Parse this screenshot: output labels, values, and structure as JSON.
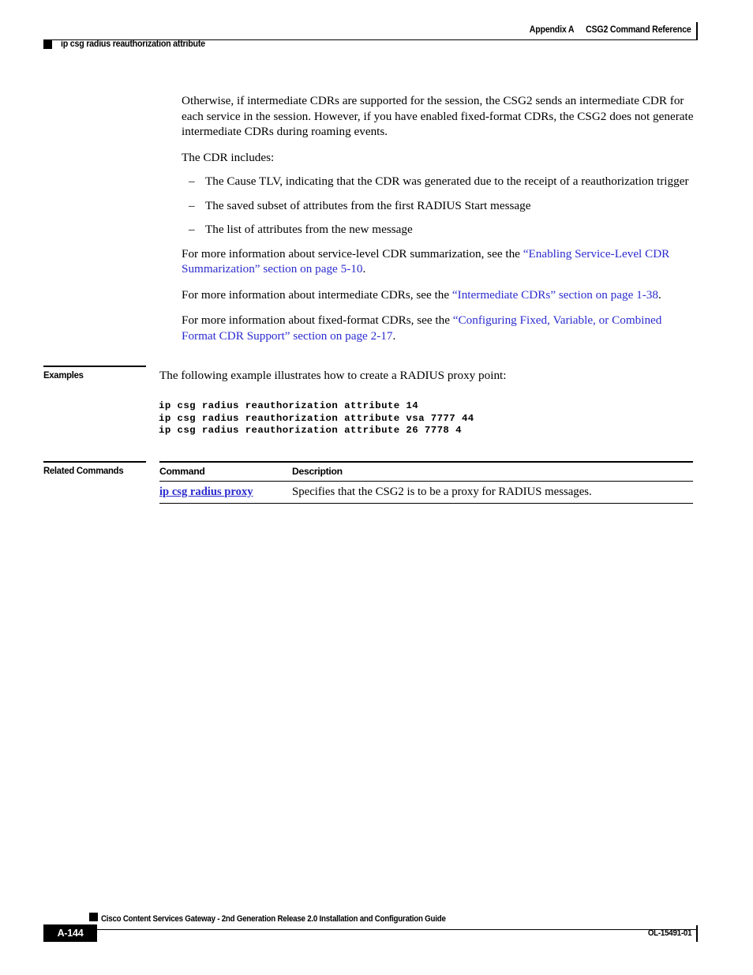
{
  "header": {
    "appendix": "Appendix A",
    "chapter_title": "CSG2 Command Reference",
    "command_title": "ip csg radius reauthorization attribute"
  },
  "body": {
    "intro_paragraph": "Otherwise, if intermediate CDRs are supported for the session, the CSG2 sends an intermediate CDR for each service in the session. However, if you have enabled fixed-format CDRs, the CSG2 does not generate intermediate CDRs during roaming events.",
    "cdr_includes_label": "The CDR includes:",
    "bullets": [
      {
        "dash": "–",
        "text": "The Cause TLV, indicating that the CDR was generated due to the receipt of a reauthorization trigger"
      },
      {
        "dash": "–",
        "text": "The saved subset of attributes from the first RADIUS Start message"
      },
      {
        "dash": "–",
        "text": "The list of attributes from the new message"
      }
    ],
    "xrefs": [
      {
        "lead": "For more information about service-level CDR summarization, see the ",
        "link": "“Enabling Service-Level CDR Summarization” section on page 5-10",
        "tail": "."
      },
      {
        "lead": "For more information about intermediate CDRs, see the ",
        "link": "“Intermediate CDRs” section on page 1-38",
        "tail": "."
      },
      {
        "lead": "For more information about fixed-format CDRs, see the ",
        "link": "“Configuring Fixed, Variable, or Combined Format CDR Support” section on page 2-17",
        "tail": "."
      }
    ]
  },
  "examples": {
    "label": "Examples",
    "intro": "The following example illustrates how to create a RADIUS proxy point:",
    "code": "ip csg radius reauthorization attribute 14\nip csg radius reauthorization attribute vsa 7777 44\nip csg radius reauthorization attribute 26 7778 4"
  },
  "related_commands": {
    "label": "Related Commands",
    "columns": [
      "Command",
      "Description"
    ],
    "rows": [
      {
        "command": "ip csg radius proxy",
        "description": "Specifies that the CSG2 is to be a proxy for RADIUS messages."
      }
    ]
  },
  "footer": {
    "guide_title": "Cisco Content Services Gateway - 2nd Generation Release 2.0 Installation and Configuration Guide",
    "page_number": "A-144",
    "doc_id": "OL-15491-01"
  },
  "colors": {
    "link": "#2b2bcf",
    "rule": "#000000",
    "page_background": "#ffffff"
  }
}
